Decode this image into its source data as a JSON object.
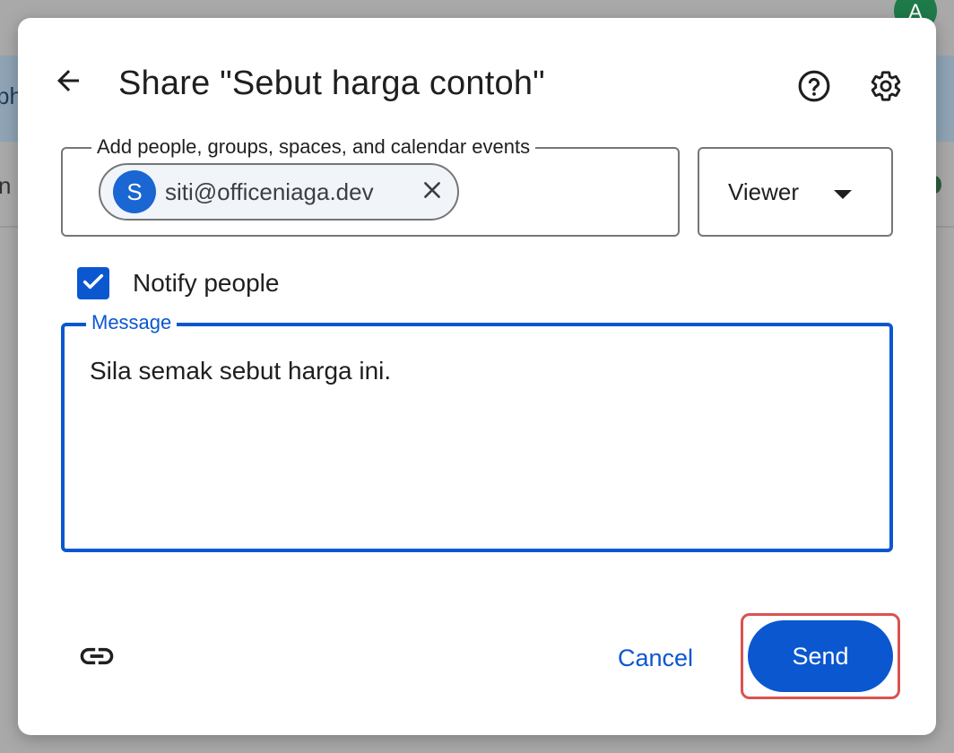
{
  "background": {
    "fragment_1": "ph",
    "fragment_2": "n c",
    "avatar_letter": "A"
  },
  "dialog": {
    "title": "Share \"Sebut harga contoh\"",
    "icons": {
      "back": "arrow-back-icon",
      "help": "help-icon",
      "settings": "gear-icon",
      "remove": "close-icon",
      "dropdown": "caret-down-icon",
      "check": "check-icon",
      "link": "link-icon"
    },
    "people_field": {
      "label": "Add people, groups, spaces, and calendar events",
      "chips": [
        {
          "initial": "S",
          "email": "siti@officeniaga.dev"
        }
      ]
    },
    "role": {
      "selected": "Viewer"
    },
    "notify": {
      "label": "Notify people",
      "checked": true
    },
    "message": {
      "label": "Message",
      "value": "Sila semak sebut harga ini."
    },
    "footer": {
      "cancel_label": "Cancel",
      "send_label": "Send"
    }
  },
  "colors": {
    "accent": "#0b57d0",
    "highlight": "#d9534f"
  }
}
